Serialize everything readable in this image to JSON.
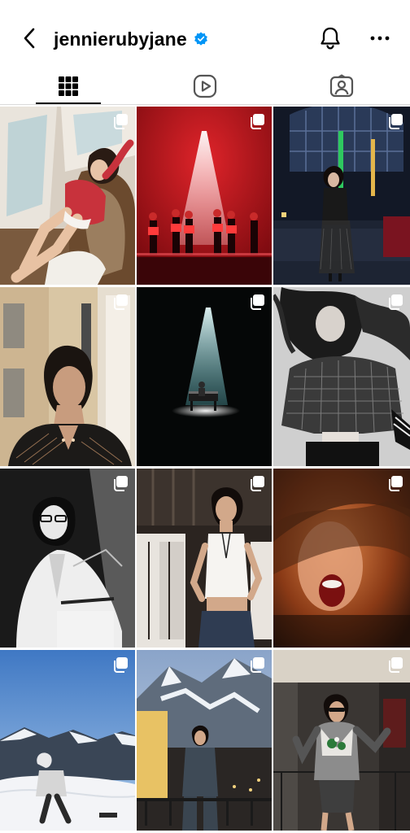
{
  "header": {
    "username": "jennierubyjane",
    "verified": true,
    "back_icon": "chevron-left-icon",
    "notifications_icon": "bell-icon",
    "more_icon": "more-horizontal-icon"
  },
  "tabs": [
    {
      "name": "posts",
      "icon": "grid-icon",
      "selected": true
    },
    {
      "name": "reels",
      "icon": "reels-icon",
      "selected": false
    },
    {
      "name": "tagged",
      "icon": "tagged-user-icon",
      "selected": false
    }
  ],
  "colors": {
    "verified_blue": "#0095f6",
    "text": "#000000",
    "divider": "#dbdbdb"
  },
  "posts": [
    {
      "scene": "window-lounge",
      "multi_image": true
    },
    {
      "scene": "red-stage",
      "multi_image": true
    },
    {
      "scene": "night-venue",
      "multi_image": true
    },
    {
      "scene": "hotel-portrait",
      "multi_image": true
    },
    {
      "scene": "piano-spotlight",
      "multi_image": true
    },
    {
      "scene": "bw-jacket",
      "multi_image": true
    },
    {
      "scene": "bw-glasses",
      "multi_image": true
    },
    {
      "scene": "white-tank-closet",
      "multi_image": true
    },
    {
      "scene": "blurred-scream",
      "multi_image": true
    },
    {
      "scene": "snow-mountain",
      "multi_image": true
    },
    {
      "scene": "ski-town-night",
      "multi_image": true
    },
    {
      "scene": "balcony-sunglasses",
      "multi_image": true
    }
  ]
}
